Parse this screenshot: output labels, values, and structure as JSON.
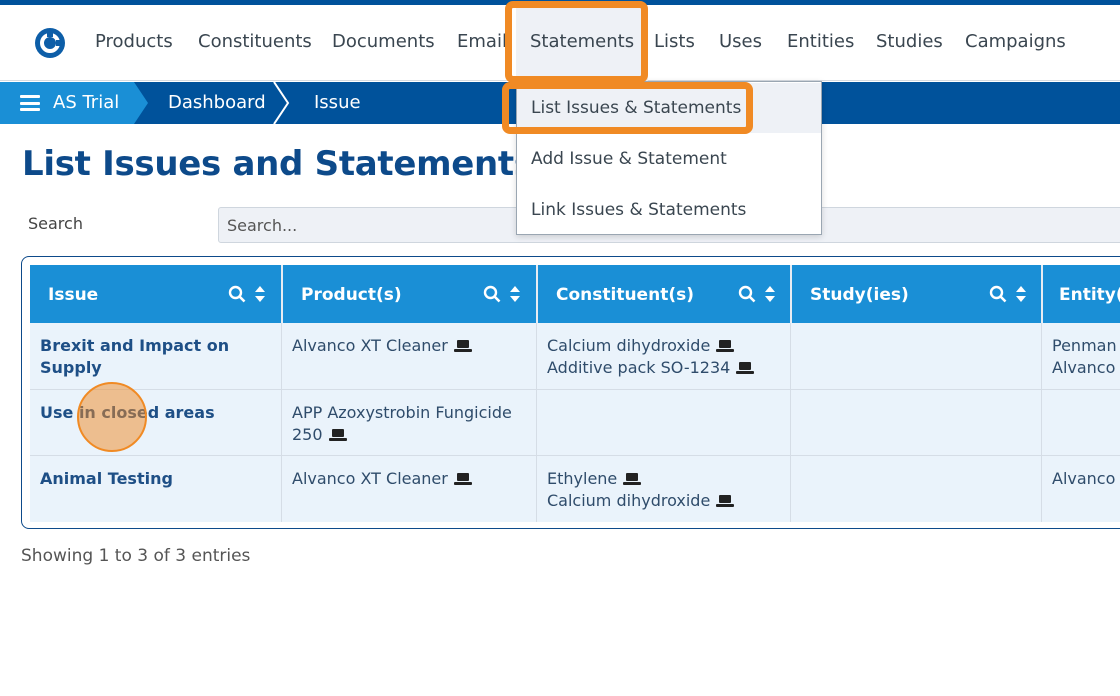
{
  "nav": {
    "items": [
      "Products",
      "Constituents",
      "Documents",
      "Email",
      "Statements",
      "Lists",
      "Uses",
      "Entities",
      "Studies",
      "Campaigns"
    ],
    "active": "Statements"
  },
  "breadcrumb": {
    "root": "AS Trial",
    "items": [
      "Dashboard",
      "Issue"
    ]
  },
  "page": {
    "title": "List Issues and Statements"
  },
  "search": {
    "label": "Search",
    "placeholder": "Search..."
  },
  "dropdown": {
    "items": [
      "List Issues & Statements",
      "Add Issue & Statement",
      "Link Issues & Statements"
    ],
    "highlighted": "List Issues & Statements"
  },
  "table": {
    "columns": [
      "Issue",
      "Product(s)",
      "Constituent(s)",
      "Study(ies)",
      "Entity(i"
    ],
    "rows": [
      {
        "issue": "Brexit and Impact on Supply",
        "products": [
          "Alvanco XT Cleaner"
        ],
        "constituents": [
          "Calcium dihydroxide",
          "Additive pack SO-1234"
        ],
        "studies": [],
        "entities": [
          "Penman",
          "Alvanco C"
        ]
      },
      {
        "issue": "Use in closed areas",
        "products": [
          "APP Azoxystrobin Fungicide 250"
        ],
        "constituents": [],
        "studies": [],
        "entities": []
      },
      {
        "issue": "Animal Testing",
        "products": [
          "Alvanco XT Cleaner"
        ],
        "constituents": [
          "Ethylene",
          "Calcium dihydroxide"
        ],
        "studies": [],
        "entities": [
          "Alvanco C"
        ]
      }
    ]
  },
  "footer": {
    "info": "Showing 1 to 3 of 3 entries"
  },
  "icons": {
    "logo": "app-logo-icon",
    "menu": "hamburger-menu-icon",
    "search": "search-icon",
    "sort": "sort-icon",
    "product_link": "laptop-icon"
  },
  "colors": {
    "brand": "#00529b",
    "accent": "#1a8fd6",
    "title": "#0d4a8a",
    "highlight": "#f08a24",
    "row_bg": "#eaf3fb"
  }
}
